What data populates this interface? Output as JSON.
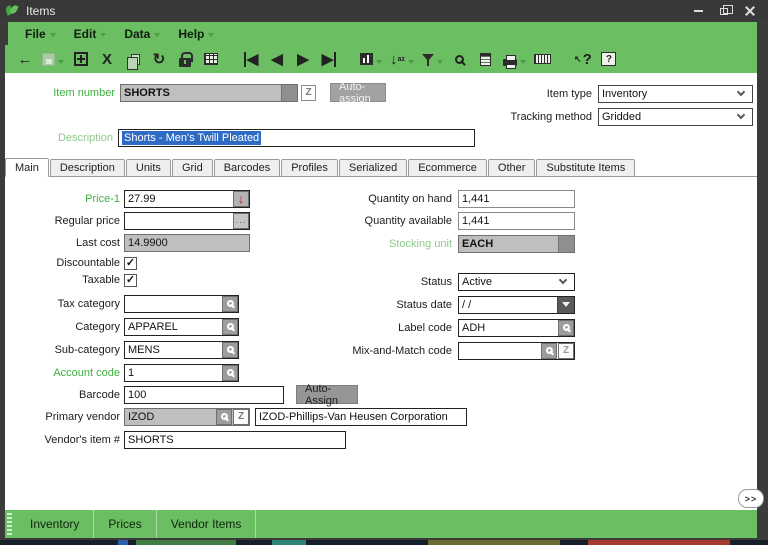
{
  "window": {
    "title": "Items"
  },
  "menu": {
    "items": [
      {
        "label": "File"
      },
      {
        "label": "Edit"
      },
      {
        "label": "Data"
      },
      {
        "label": "Help"
      }
    ]
  },
  "toolbar": {
    "icons": [
      {
        "name": "back-icon",
        "glyph": "←"
      },
      {
        "name": "save-icon"
      },
      {
        "name": "add-icon"
      },
      {
        "name": "delete-icon",
        "glyph": "X"
      },
      {
        "name": "copy-icon"
      },
      {
        "name": "refresh-icon",
        "glyph": "↻"
      },
      {
        "name": "lock-icon"
      },
      {
        "name": "grid-edit-icon"
      },
      {
        "name": "first-record-icon",
        "glyph": "◀"
      },
      {
        "name": "previous-record-icon",
        "glyph": "◀"
      },
      {
        "name": "next-record-icon",
        "glyph": "▶"
      },
      {
        "name": "last-record-icon",
        "glyph": "▶"
      },
      {
        "name": "chart-icon"
      },
      {
        "name": "sort-icon",
        "glyph": "↓",
        "detail": "az"
      },
      {
        "name": "filter-icon"
      },
      {
        "name": "search-icon"
      },
      {
        "name": "notes-icon"
      },
      {
        "name": "print-icon"
      },
      {
        "name": "barcode-icon"
      },
      {
        "name": "context-help-icon",
        "glyph": "?",
        "detail": "↖"
      },
      {
        "name": "help-icon",
        "glyph": "?"
      }
    ]
  },
  "header": {
    "item_number": {
      "label": "Item number",
      "value": "SHORTS",
      "auto_assign": "Auto-assign"
    },
    "item_type": {
      "label": "Item type",
      "value": "Inventory"
    },
    "tracking_method": {
      "label": "Tracking method",
      "value": "Gridded"
    },
    "description": {
      "label": "Description",
      "value": "Shorts - Men's Twill Pleated"
    }
  },
  "tabs": {
    "items": [
      {
        "label": "Main",
        "active": true
      },
      {
        "label": "Description"
      },
      {
        "label": "Units"
      },
      {
        "label": "Grid"
      },
      {
        "label": "Barcodes"
      },
      {
        "label": "Profiles"
      },
      {
        "label": "Serialized"
      },
      {
        "label": "Ecommerce"
      },
      {
        "label": "Other"
      },
      {
        "label": "Substitute Items"
      }
    ]
  },
  "fields": {
    "price1": {
      "label": "Price-1",
      "value": "27.99"
    },
    "regular_price": {
      "label": "Regular price",
      "value": ""
    },
    "last_cost": {
      "label": "Last cost",
      "value": "14.9900"
    },
    "discountable": {
      "label": "Discountable",
      "checked": true
    },
    "taxable": {
      "label": "Taxable",
      "checked": true
    },
    "tax_category": {
      "label": "Tax category",
      "value": ""
    },
    "category": {
      "label": "Category",
      "value": "APPAREL"
    },
    "sub_category": {
      "label": "Sub-category",
      "value": "MENS"
    },
    "account_code": {
      "label": "Account code",
      "value": "1"
    },
    "barcode": {
      "label": "Barcode",
      "value": "100",
      "auto_assign": "Auto-Assign"
    },
    "primary_vendor": {
      "label": "Primary vendor",
      "value": "IZOD",
      "company": "IZOD-Phillips-Van Heusen Corporation"
    },
    "vendors_item": {
      "label": "Vendor's item #",
      "value": "SHORTS"
    },
    "qty_on_hand": {
      "label": "Quantity on hand",
      "value": "1,441"
    },
    "qty_available": {
      "label": "Quantity available",
      "value": "1,441"
    },
    "stocking_unit": {
      "label": "Stocking unit",
      "value": "EACH"
    },
    "status": {
      "label": "Status",
      "value": "Active"
    },
    "status_date": {
      "label": "Status date",
      "value": "/ /"
    },
    "label_code": {
      "label": "Label code",
      "value": "ADH"
    },
    "mix_match": {
      "label": "Mix-and-Match code",
      "value": ""
    }
  },
  "bottom": {
    "tabs": [
      {
        "label": "Inventory"
      },
      {
        "label": "Prices"
      },
      {
        "label": "Vendor Items"
      }
    ],
    "expand": ">>"
  },
  "ui": {
    "check": "✓",
    "z": "Z",
    "ellipsis": "...",
    "down_arrow": "↓"
  },
  "colors": {
    "accent_green": "#6cbe62",
    "titlebar": "#383838",
    "selection": "#2e6bc4",
    "label_green": "#3fae3f",
    "label_green_light": "#8cc98c",
    "price_arrow_red": "#c41e1e"
  }
}
